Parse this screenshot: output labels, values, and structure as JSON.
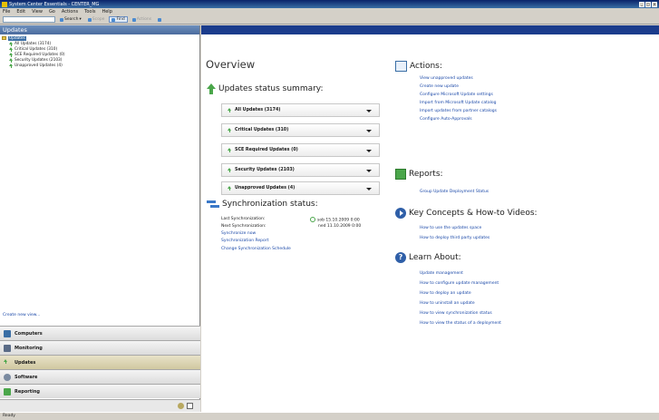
{
  "window": {
    "title": "System Center Essentials - CENTER_MG",
    "controls": [
      "_",
      "□",
      "×"
    ]
  },
  "menu": [
    "File",
    "Edit",
    "View",
    "Go",
    "Actions",
    "Tools",
    "Help"
  ],
  "toolbar": {
    "search_value": "",
    "search_label": "Search",
    "scope_label": "Scope",
    "find_label": "Find",
    "actions_label": "Actions"
  },
  "nav": {
    "header": "Updates",
    "tree": {
      "root": "Updates",
      "children": [
        "All Updates (3174)",
        "Critical Updates (310)",
        "SCE Required Updates (0)",
        "Security Updates (2103)",
        "Unapproved Updates (4)"
      ]
    },
    "create_view": "Create new view...",
    "wunderbar": [
      "Computers",
      "Monitoring",
      "Updates",
      "Software",
      "Reporting"
    ],
    "colors": {
      "computers": "#3a6ea5",
      "monitoring": "#5a6b86",
      "updates": "#4aa64a",
      "software": "#7a8aa0",
      "reporting": "#4aa64a"
    }
  },
  "main": {
    "title": "Overview",
    "summary": {
      "heading": "Updates status summary:",
      "items": [
        "All Updates (3174)",
        "Critical Updates (310)",
        "SCE Required Updates (0)",
        "Security Updates (2103)",
        "Unapproved Updates (4)"
      ]
    },
    "sync": {
      "heading": "Synchronization status:",
      "last_label": "Last Synchronization:",
      "last_value": "sob 15.10.2009 0:00",
      "next_label": "Next Synchronization:",
      "next_value": "ned 11.10.2009 0:00",
      "links": [
        "Synchronize now",
        "Synchronization Report",
        "Change Synchronization Schedule"
      ]
    },
    "actions": {
      "heading": "Actions:",
      "links": [
        "View unapproved updates",
        "Create new update",
        "Configure Microsoft Update settings",
        "Import from Microsoft Update catalog",
        "Import updates from partner catalogs",
        "Configure Auto-Approvals"
      ]
    },
    "reports": {
      "heading": "Reports:",
      "links": [
        "Group Update Deployment Status"
      ]
    },
    "videos": {
      "heading": "Key Concepts & How-to Videos:",
      "links": [
        "How to use the updates space",
        "How to deploy third party updates"
      ]
    },
    "learn": {
      "heading": "Learn About:",
      "links": [
        "Update management",
        "How to configure update management",
        "How to deploy an update",
        "How to uninstall an update",
        "How to view synchronization status",
        "How to view the status of a deployment"
      ]
    }
  },
  "status": {
    "text": "Ready"
  }
}
